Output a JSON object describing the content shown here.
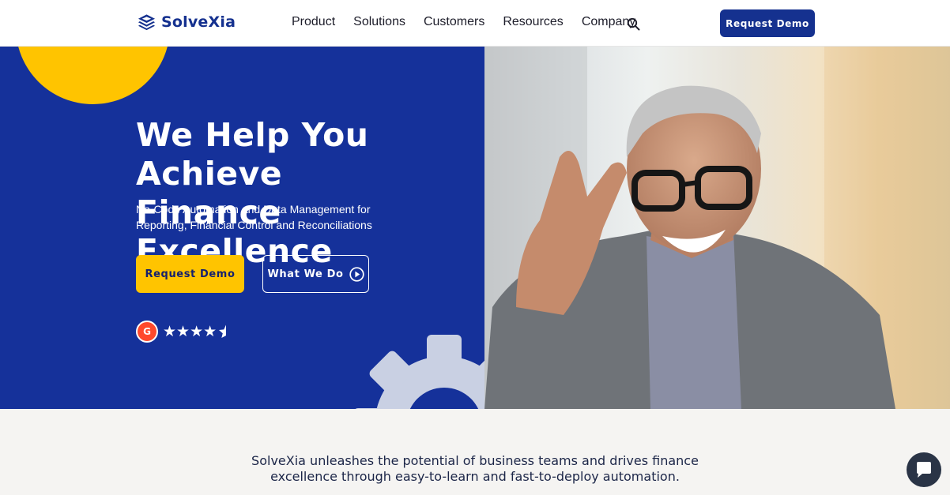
{
  "header": {
    "logo_text": "SolveXia",
    "nav": [
      "Product",
      "Solutions",
      "Customers",
      "Resources",
      "Company"
    ],
    "search_icon": "search-icon",
    "cta_label": "Request Demo"
  },
  "hero": {
    "title_line1": "We Help You Achieve",
    "title_line2": "Finance Excellence",
    "subtitle_line1": "No-Code Automation and Data Management for",
    "subtitle_line2": "Reporting, Financial Control and Reconciliations",
    "primary_cta": "Request Demo",
    "secondary_cta": "What We Do",
    "rating": {
      "badge_text": "G",
      "stars": "★★★★",
      "rating_value": 4.5
    }
  },
  "tagline": {
    "line1": "SolveXia unleashes the potential of business teams and drives finance",
    "line2": "excellence through easy-to-learn and fast-to-deploy automation."
  },
  "colors": {
    "brand_blue": "#15319a",
    "accent_yellow": "#ffc400",
    "g2_red": "#ff492c"
  }
}
